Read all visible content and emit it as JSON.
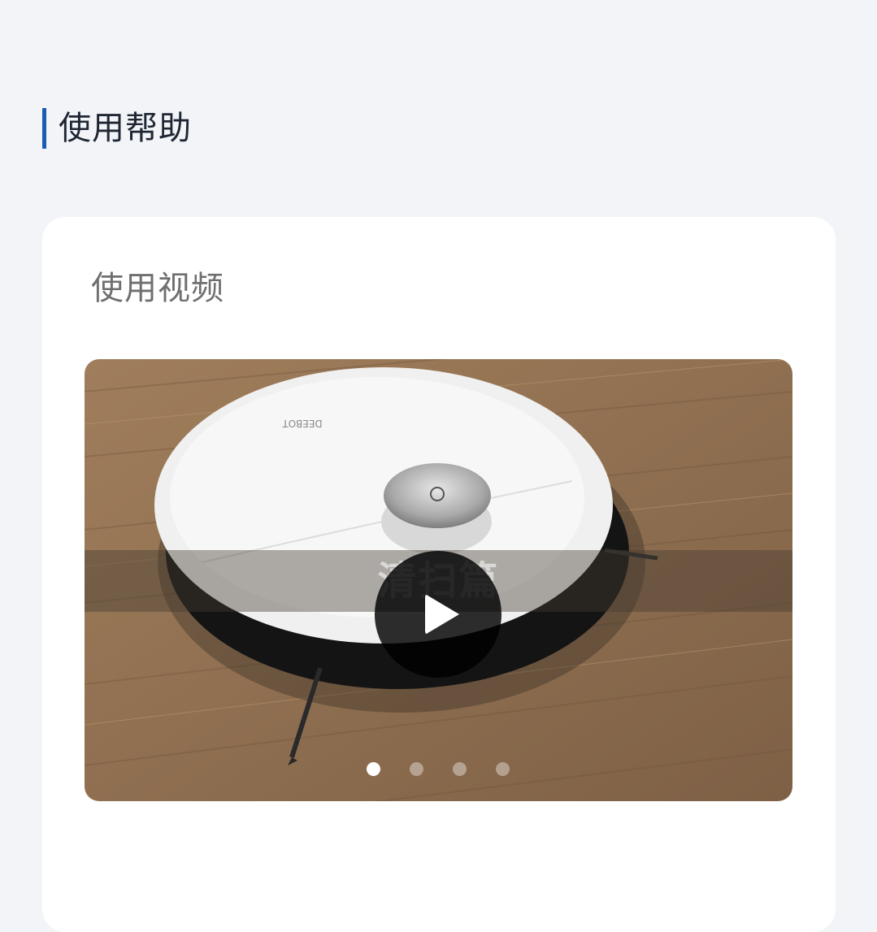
{
  "section": {
    "title": "使用帮助"
  },
  "card": {
    "title": "使用视频",
    "carousel": {
      "slides": [
        {
          "caption": "清扫篇",
          "brand": "DEEBOT"
        },
        {
          "caption": ""
        },
        {
          "caption": ""
        },
        {
          "caption": ""
        }
      ],
      "active_index": 0,
      "slide_count": 4
    }
  },
  "icons": {
    "play": "play-icon"
  },
  "colors": {
    "accent": "#1a5cb0",
    "background": "#f2f4f8",
    "card": "#ffffff"
  }
}
